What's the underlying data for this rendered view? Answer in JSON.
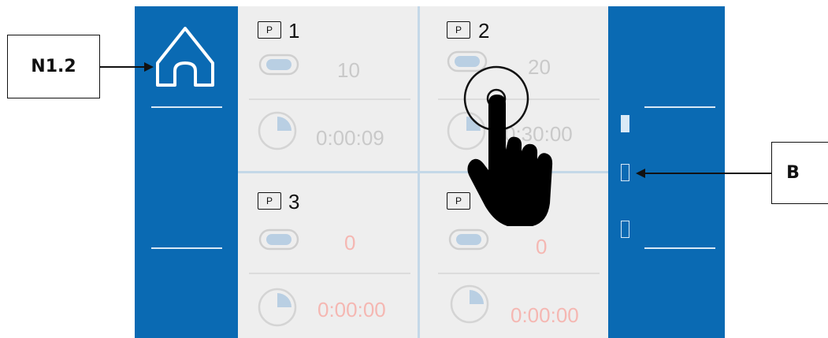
{
  "callouts": {
    "left_label": "N1.2",
    "right_label": "B"
  },
  "cells": [
    {
      "badge": "P",
      "number": "1",
      "count": "10",
      "time": "0:00:09",
      "alarm": false
    },
    {
      "badge": "P",
      "number": "2",
      "count": "20",
      "time": "0:30:00",
      "alarm": false
    },
    {
      "badge": "P",
      "number": "3",
      "count": "0",
      "time": "0:00:00",
      "alarm": true
    },
    {
      "badge": "P",
      "number": "",
      "count": "0",
      "time": "0:00:00",
      "alarm": true
    }
  ],
  "colors": {
    "panel_blue": "#0a6ab3",
    "tile_bg": "#eeeeee",
    "alarm_red": "#f5b7b2"
  },
  "icons": [
    "home-icon",
    "folder-p-icon",
    "counter-pill-icon",
    "timer-pie-icon",
    "touch-hand-icon",
    "arrow-icon"
  ]
}
